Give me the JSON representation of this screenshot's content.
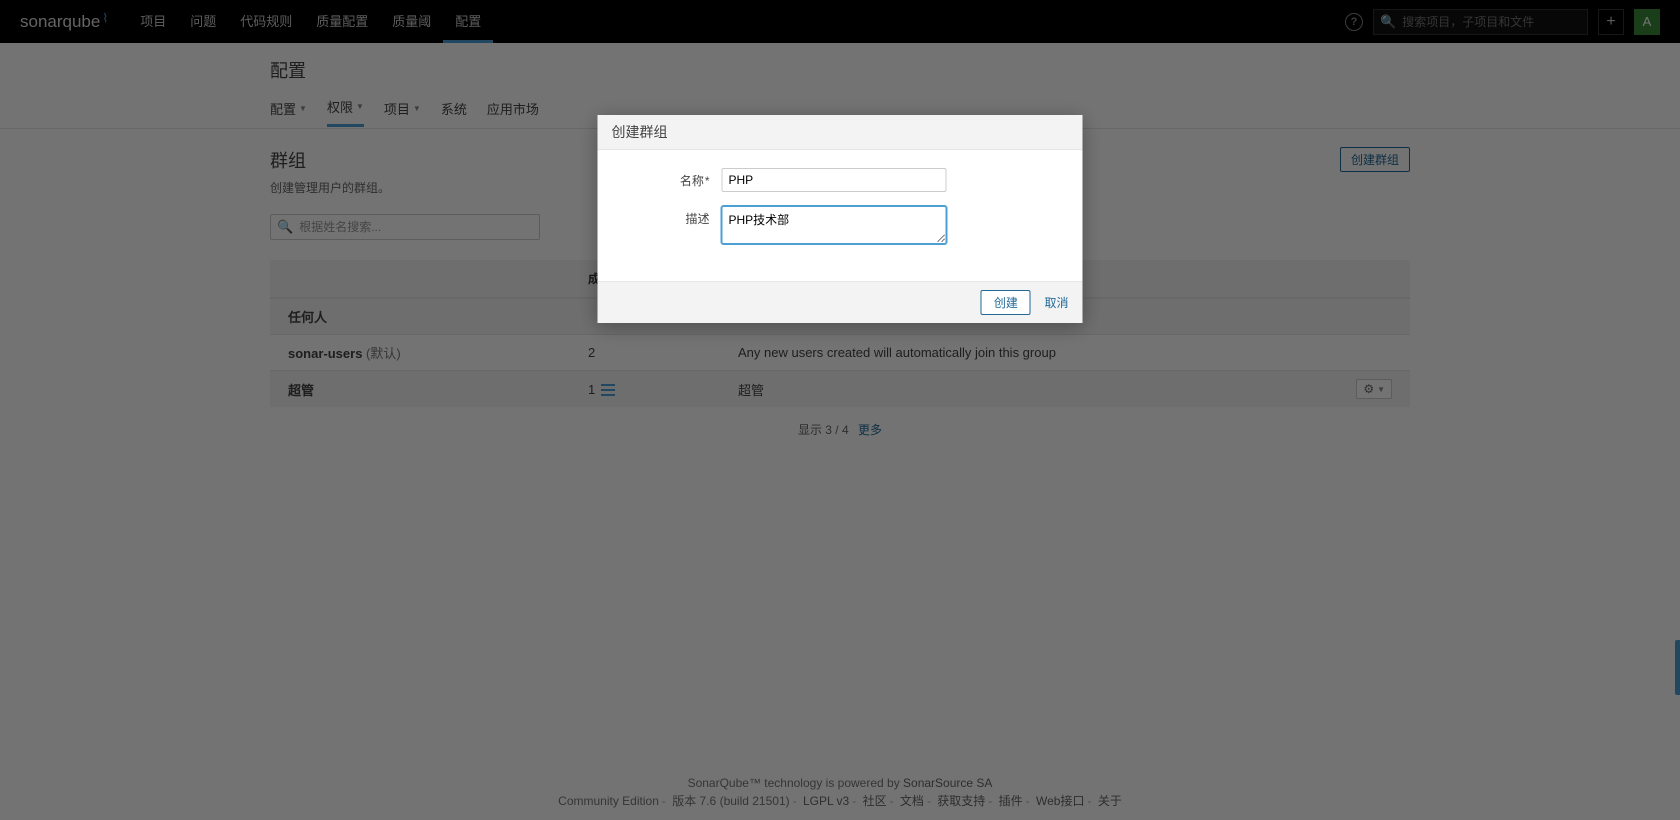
{
  "brand": "sonarqube",
  "topnav": {
    "items": [
      {
        "label": "项目"
      },
      {
        "label": "问题"
      },
      {
        "label": "代码规则"
      },
      {
        "label": "质量配置"
      },
      {
        "label": "质量阈"
      },
      {
        "label": "配置",
        "active": true
      }
    ],
    "search_placeholder": "搜索项目，子项目和文件",
    "avatar_letter": "A"
  },
  "header": {
    "title": "配置",
    "subtabs": [
      {
        "label": "配置",
        "caret": true
      },
      {
        "label": "权限",
        "caret": true,
        "active": true
      },
      {
        "label": "项目",
        "caret": true
      },
      {
        "label": "系统"
      },
      {
        "label": "应用市场"
      }
    ]
  },
  "content": {
    "title": "群组",
    "desc": "创建管理用户的群组。",
    "create_button": "创建群组",
    "search_placeholder": "根据姓名搜索...",
    "columns": {
      "members": "成员"
    },
    "rows": [
      {
        "name": "任何人",
        "members": "",
        "desc": ""
      },
      {
        "name": "sonar-users",
        "suffix": "(默认)",
        "members": "2",
        "desc": "Any new users created will automatically join this group"
      },
      {
        "name": "超管",
        "members": "1",
        "members_icon": true,
        "desc": "超管",
        "gear": true
      }
    ],
    "footer_text": "显示 3 / 4",
    "footer_more": "更多"
  },
  "modal": {
    "title": "创建群组",
    "name_label": "名称",
    "name_value": "PHP",
    "desc_label": "描述",
    "desc_value": "PHP技术部",
    "submit": "创建",
    "cancel": "取消"
  },
  "footer": {
    "line1_a": "SonarQube™ technology is powered by ",
    "line1_b": "SonarSource SA",
    "edition": "Community Edition",
    "version": "版本 7.6 (build 21501)",
    "links": [
      "LGPL v3",
      "社区",
      "文档",
      "获取支持",
      "插件",
      "Web接口",
      "关于"
    ]
  }
}
